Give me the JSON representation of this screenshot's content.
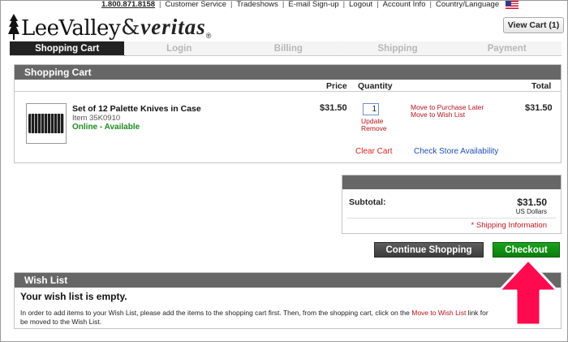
{
  "toplinks": {
    "phone": "1.800.871.8158",
    "customer_service": "Customer Service",
    "tradeshows": "Tradeshows",
    "email_signup": "E-mail Sign-up",
    "logout": "Logout",
    "account_info": "Account Info",
    "country_language": "Country/Language"
  },
  "logo": {
    "lee_valley": "LeeValley",
    "amp": "&",
    "veritas": "veritas",
    "reg": "®"
  },
  "header": {
    "view_cart": "View Cart (1)"
  },
  "steps": [
    {
      "label": "Shopping Cart",
      "active": true
    },
    {
      "label": "Login",
      "active": false
    },
    {
      "label": "Billing",
      "active": false
    },
    {
      "label": "Shipping",
      "active": false
    },
    {
      "label": "Payment",
      "active": false
    }
  ],
  "cart": {
    "title": "Shopping Cart",
    "col_price": "Price",
    "col_quantity": "Quantity",
    "col_total": "Total",
    "item": {
      "name": "Set of 12 Palette Knives in Case",
      "number": "Item 35K0910",
      "availability": "Online - Available",
      "price": "$31.50",
      "quantity": "1",
      "update": "Update",
      "remove": "Remove",
      "move_later": "Move to Purchase Later",
      "move_wish": "Move to Wish List",
      "total": "$31.50"
    },
    "clear_cart": "Clear Cart",
    "check_store": "Check Store Availability"
  },
  "summary": {
    "subtotal_label": "Subtotal:",
    "subtotal_value": "$31.50",
    "currency": "US Dollars",
    "shipping_info": "* Shipping Information"
  },
  "actions": {
    "continue_shopping": "Continue Shopping",
    "checkout": "Checkout"
  },
  "wishlist": {
    "title": "Wish List",
    "empty": "Your wish list is empty.",
    "text_before": "In order to add items to your Wish List, please add the items to the shopping cart first. Then, from the shopping cart, click on the ",
    "link": "Move to Wish List",
    "text_after": " link for",
    "text_after2": "be moved to the Wish List."
  },
  "colors": {
    "panel_header": "#676767",
    "checkout_green": "#0d7d0d",
    "link_red": "#b5121b",
    "arrow_pink": "#ff0a4e"
  }
}
